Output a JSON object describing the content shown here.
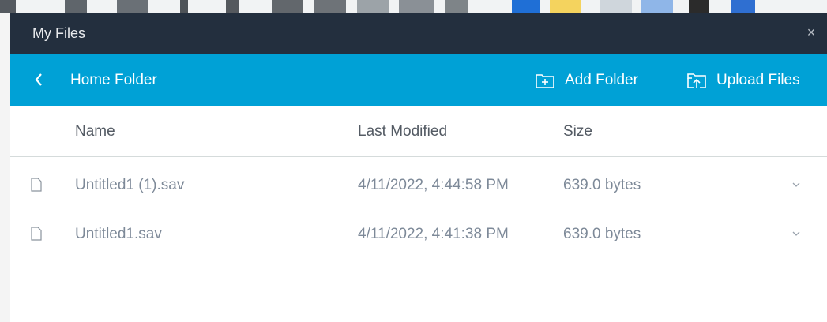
{
  "window": {
    "title": "My Files",
    "close_glyph": "×"
  },
  "navigation": {
    "back_icon": "chevron-left-icon",
    "current_folder": "Home Folder"
  },
  "actions": {
    "add_folder_label": "Add Folder",
    "add_folder_icon": "add-folder-icon",
    "upload_files_label": "Upload Files",
    "upload_files_icon": "upload-icon"
  },
  "table": {
    "columns": [
      "Name",
      "Last Modified",
      "Size"
    ],
    "rows": [
      {
        "name": "Untitled1 (1).sav",
        "last_modified": "4/11/2022, 4:44:58 PM",
        "size": "639.0 bytes",
        "icon": "file-icon"
      },
      {
        "name": "Untitled1.sav",
        "last_modified": "4/11/2022, 4:41:38 PM",
        "size": "639.0 bytes",
        "icon": "file-icon"
      }
    ]
  },
  "colors": {
    "titlebar_bg": "#232f3e",
    "folderbar_bg": "#00a1d6",
    "muted_text": "#7d8998",
    "header_text": "#545b64"
  }
}
